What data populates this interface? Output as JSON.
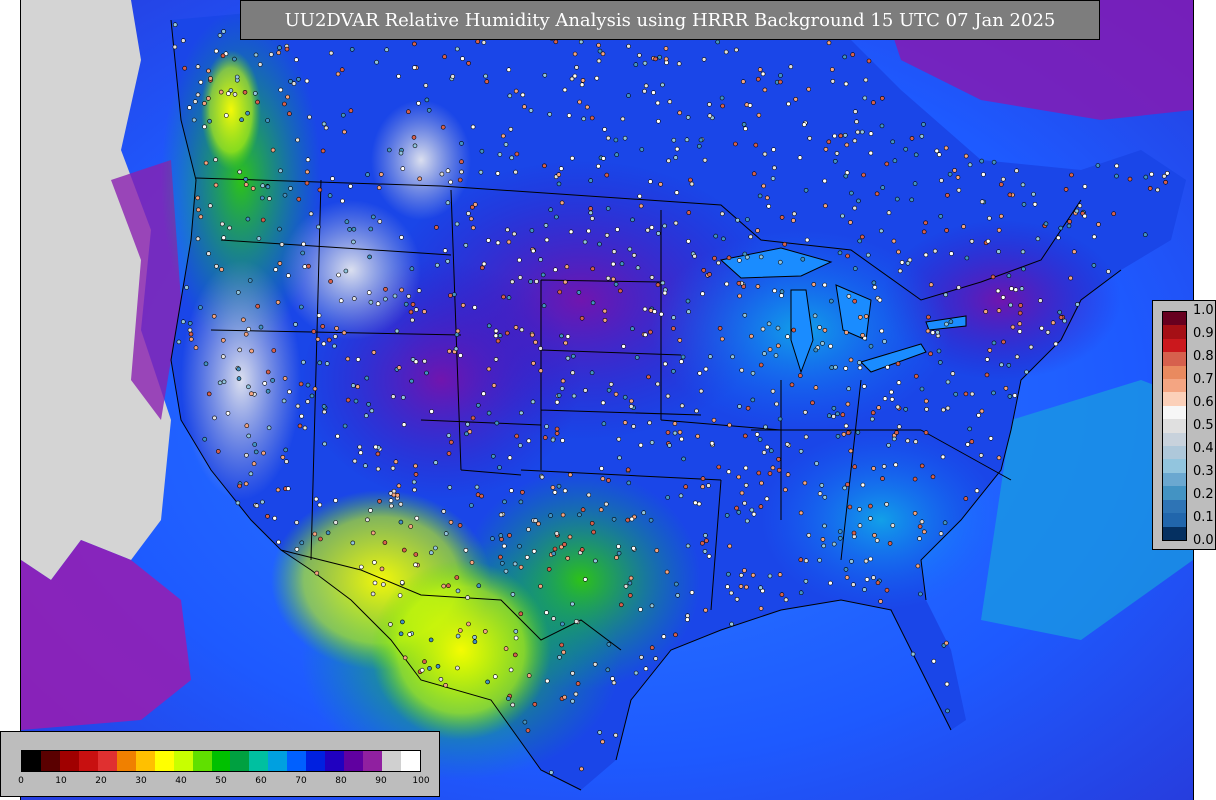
{
  "title": "UU2DVAR Relative Humidity Analysis using HRRR Background 15 UTC 07 Jan 2025",
  "relative_humidity_scale": {
    "ticks": [
      "0",
      "10",
      "20",
      "30",
      "40",
      "50",
      "60",
      "70",
      "80",
      "90",
      "100"
    ],
    "colors": [
      "#000000",
      "#5a0000",
      "#a00000",
      "#c81010",
      "#e03030",
      "#f08000",
      "#ffc000",
      "#ffff00",
      "#c8ff00",
      "#60e000",
      "#00c000",
      "#00a040",
      "#00c0a0",
      "#00a0e0",
      "#0060ff",
      "#0020e0",
      "#2000c0",
      "#6000a0",
      "#9020a0",
      "#d0d0d0",
      "#ffffff"
    ]
  },
  "innovation_scale": {
    "ticks": [
      "1.0",
      "0.9",
      "0.8",
      "0.7",
      "0.6",
      "0.5",
      "0.4",
      "0.3",
      "0.2",
      "0.1",
      "0.0"
    ],
    "colors": [
      "#67001f",
      "#a50f15",
      "#cb181d",
      "#d6604d",
      "#e98a5f",
      "#f4a582",
      "#fbd0b9",
      "#f7f7f7",
      "#e0e0e0",
      "#c8d2dc",
      "#aec8da",
      "#92c5de",
      "#6ba8d0",
      "#4393c3",
      "#2e74b5",
      "#2166ac",
      "#053061"
    ]
  }
}
